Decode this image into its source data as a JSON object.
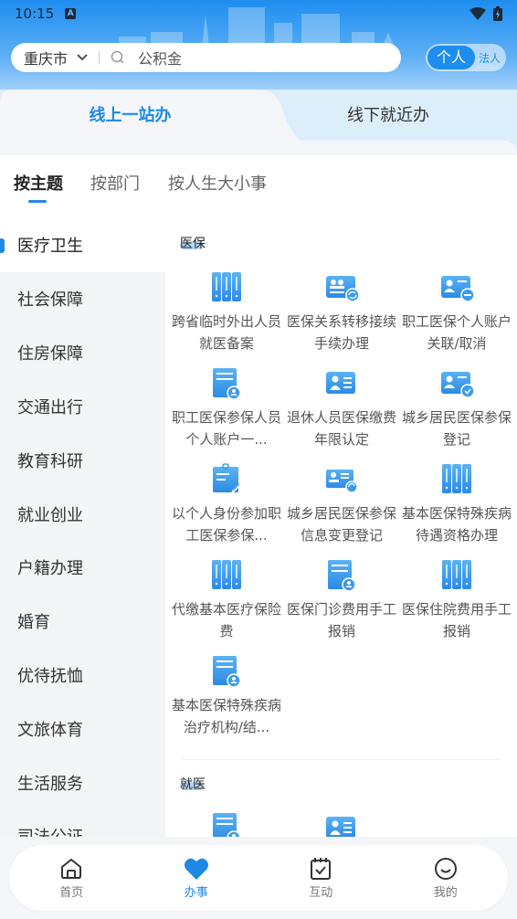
{
  "status_bar": {
    "time": "10:15",
    "notification_badge": "A"
  },
  "search": {
    "city": "重庆市",
    "query": "公积金"
  },
  "user_type_toggle": {
    "personal": "个人",
    "legal": "法人",
    "selected": "个人"
  },
  "service_tabs": [
    {
      "label": "线上一站办",
      "active": true
    },
    {
      "label": "线下就近办",
      "active": false
    }
  ],
  "category_tabs": [
    {
      "label": "按主题",
      "active": true
    },
    {
      "label": "按部门",
      "active": false
    },
    {
      "label": "按人生大小事",
      "active": false
    }
  ],
  "sidebar": {
    "items": [
      {
        "label": "医疗卫生",
        "active": true
      },
      {
        "label": "社会保障"
      },
      {
        "label": "住房保障"
      },
      {
        "label": "交通出行"
      },
      {
        "label": "教育科研"
      },
      {
        "label": "就业创业"
      },
      {
        "label": "户籍办理"
      },
      {
        "label": "婚育"
      },
      {
        "label": "优待抚恤"
      },
      {
        "label": "文旅体育"
      },
      {
        "label": "生活服务"
      },
      {
        "label": "司法公证"
      }
    ]
  },
  "sections": [
    {
      "title": "医保",
      "items": [
        {
          "label": "跨省临时外出人员就医备案",
          "icon": "binders-icon"
        },
        {
          "label": "医保关系转移接续手续办理",
          "icon": "id-card-transfer-icon"
        },
        {
          "label": "职工医保个人账户关联/取消",
          "icon": "id-card-minus-icon"
        },
        {
          "label": "职工医保参保人员个人账户一...",
          "icon": "document-person-icon"
        },
        {
          "label": "退休人员医保缴费年限认定",
          "icon": "id-card-person-icon"
        },
        {
          "label": "城乡居民医保参保登记",
          "icon": "id-card-check-icon"
        },
        {
          "label": "以个人身份参加职工医保参保...",
          "icon": "clipboard-edit-icon"
        },
        {
          "label": "城乡居民医保参保信息变更登记",
          "icon": "id-card-refresh-icon"
        },
        {
          "label": "基本医保特殊疾病待遇资格办理",
          "icon": "binders-icon"
        },
        {
          "label": "代缴基本医疗保险费",
          "icon": "binders-icon"
        },
        {
          "label": "医保门诊费用手工报销",
          "icon": "document-person-icon"
        },
        {
          "label": "医保住院费用手工报销",
          "icon": "binders-icon"
        },
        {
          "label": "基本医保特殊疾病治疗机构/结...",
          "icon": "document-person-icon"
        }
      ]
    },
    {
      "title": "就医",
      "items": [
        {
          "label": "",
          "icon": "document-person-icon"
        },
        {
          "label": "",
          "icon": "id-card-person-icon"
        }
      ]
    }
  ],
  "bottom_nav": [
    {
      "label": "首页",
      "icon": "home-icon",
      "active": false
    },
    {
      "label": "办事",
      "icon": "heart-icon",
      "active": true
    },
    {
      "label": "互动",
      "icon": "calendar-check-icon",
      "active": false
    },
    {
      "label": "我的",
      "icon": "smile-icon",
      "active": false
    }
  ],
  "colors": {
    "accent": "#1e88e5",
    "icon_blue": "#3d9bec"
  }
}
